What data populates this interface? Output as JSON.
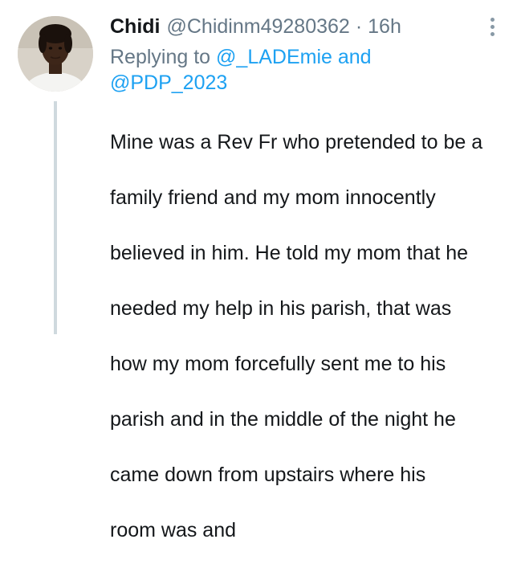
{
  "tweet": {
    "display_name": "Chidi",
    "handle": "@Chidinm49280362",
    "separator": "·",
    "time": "16h",
    "replying_prefix": "Replying to",
    "mention_1": "@_LADEmie",
    "replying_and": "and",
    "mention_2": "@PDP_2023",
    "body_lines": [
      "Mine was a Rev Fr who pretended to be a",
      "family friend and my mom innocently",
      "believed in him. He told my mom that he",
      "needed my help in his parish, that was",
      "how my mom forcefully sent me to his",
      "parish and in the middle of the night he",
      "came down from upstairs where his",
      "room was and"
    ]
  },
  "icons": {
    "more": "more-vertical-icon",
    "avatar": "profile-photo"
  },
  "colors": {
    "text": "#14171a",
    "secondary": "#657786",
    "link": "#1da1f2",
    "thread_line": "#cfd9de"
  }
}
